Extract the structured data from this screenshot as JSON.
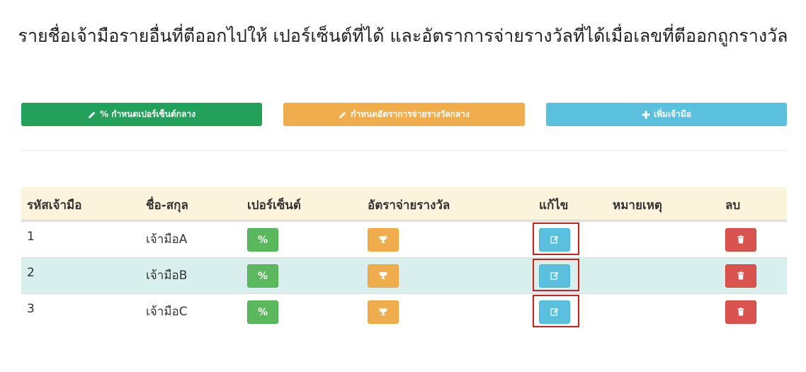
{
  "page": {
    "title": "รายชื่อเจ้ามือรายอื่นที่ตีออกไปให้ เปอร์เซ็นต์ที่ได้ และอัตราการจ่ายรางวัลที่ได้เมื่อเลขที่ตีออกถูกรางวัล"
  },
  "toolbar": {
    "set_percent_label": "% กำหนดเปอร์เซ็นต์กลาง",
    "set_payout_label": "กำหนดอัตราการจ่ายรางวัลกลาง",
    "add_dealer_label": "เพิ่มเจ้ามือ",
    "colors": {
      "green": "#23a05a",
      "yellow": "#f0ad4e",
      "cyan": "#5bc0de"
    }
  },
  "table": {
    "headers": {
      "code": "รหัสเจ้ามือ",
      "name": "ชื่อ-สกุล",
      "percent": "เปอร์เซ็นต์",
      "payout": "อัตราจ่ายรางวัล",
      "edit": "แก้ไข",
      "note": "หมายเหตุ",
      "delete": "ลบ"
    },
    "percent_button_label": "%",
    "rows": [
      {
        "code": "1",
        "name": "เจ้ามือA",
        "note": ""
      },
      {
        "code": "2",
        "name": "เจ้ามือB",
        "note": ""
      },
      {
        "code": "3",
        "name": "เจ้ามือC",
        "note": ""
      }
    ],
    "icons": {
      "percent": "percent-icon",
      "payout": "trophy-icon",
      "edit": "edit-icon",
      "delete": "trash-icon"
    },
    "highlight_color": "#cc1f1f"
  }
}
